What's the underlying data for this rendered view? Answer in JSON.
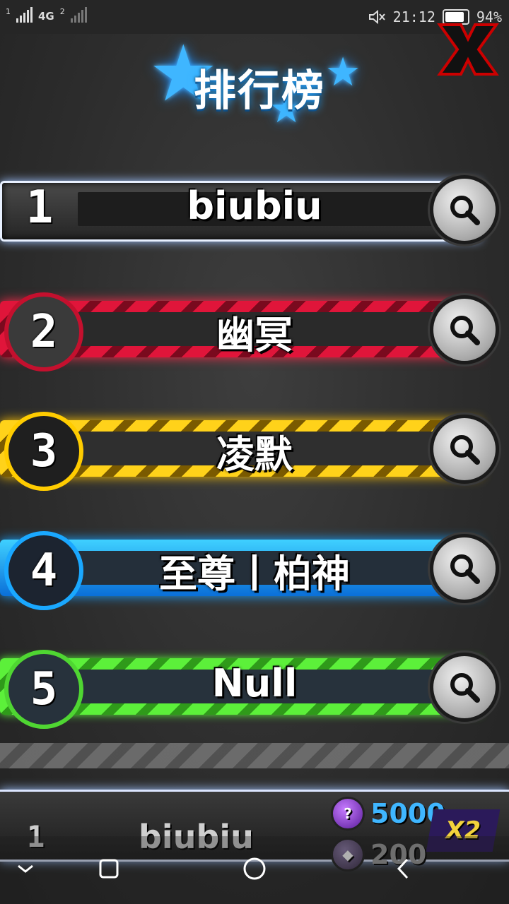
{
  "status_bar": {
    "sim1": "1",
    "network": "4G",
    "sim2": "2",
    "time": "21:12",
    "battery": "94%"
  },
  "header": {
    "title": "排行榜"
  },
  "leaderboard": [
    {
      "rank": "1",
      "name": "biubiu",
      "theme": "silver"
    },
    {
      "rank": "2",
      "name": "幽冥",
      "theme": "red"
    },
    {
      "rank": "3",
      "name": "凌默",
      "theme": "yellow"
    },
    {
      "rank": "4",
      "name": "至尊丨柏神",
      "theme": "blue"
    },
    {
      "rank": "5",
      "name": "Null",
      "theme": "green"
    }
  ],
  "my_entry": {
    "rank": "1",
    "name": "biubiu",
    "reward_primary": "5000",
    "reward_secondary": "200",
    "multiplier": "X2"
  },
  "colors": {
    "title_glow": "#2aa8ff",
    "reward_primary": "#3fb6ff",
    "reward_secondary": "#9a9a9a",
    "multiplier": "#f2d23c"
  }
}
